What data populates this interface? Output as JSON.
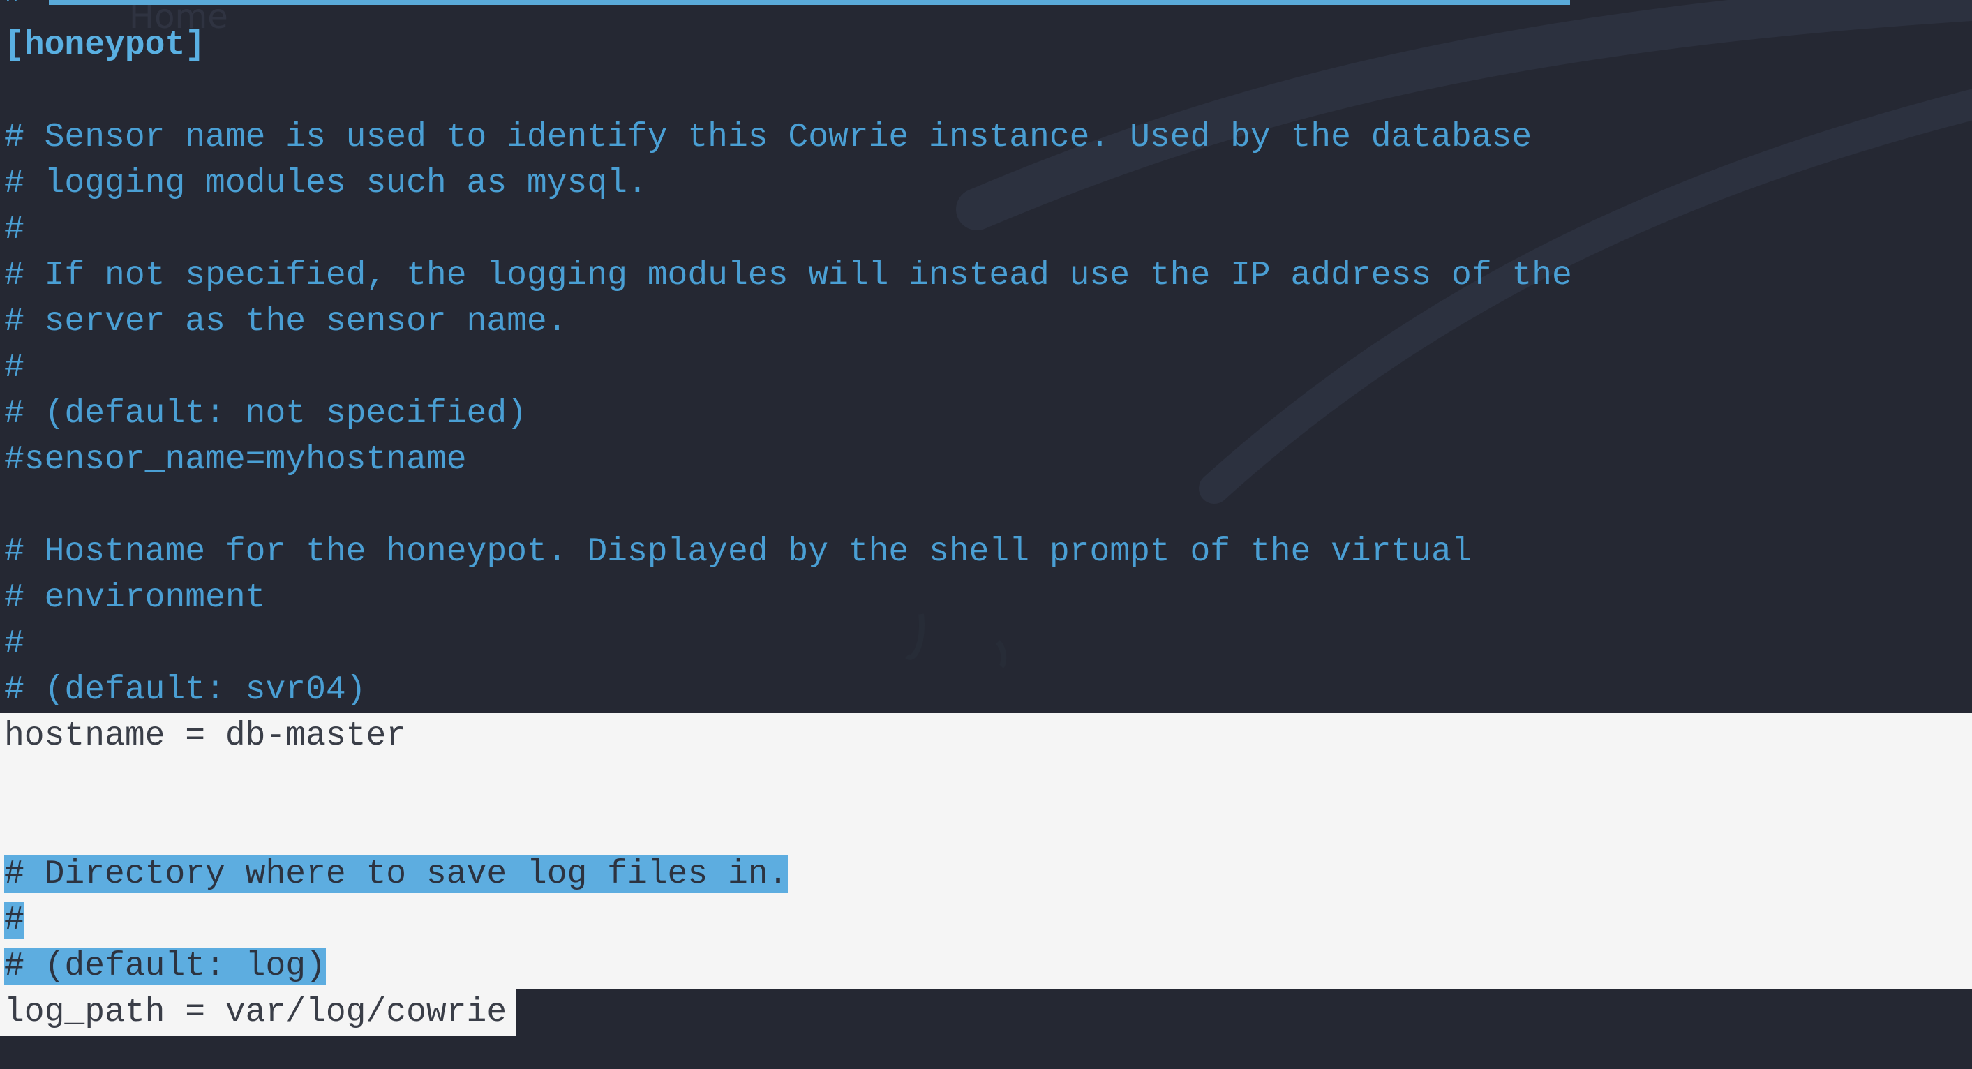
{
  "desktop": {
    "ghost_label": "Home"
  },
  "editor": {
    "top_partial_line": "#",
    "lines": [
      {
        "text": "[honeypot]",
        "kind": "section"
      },
      {
        "text": "",
        "kind": "blank"
      },
      {
        "text": "# Sensor name is used to identify this Cowrie instance. Used by the database",
        "kind": "comment"
      },
      {
        "text": "# logging modules such as mysql.",
        "kind": "comment"
      },
      {
        "text": "#",
        "kind": "comment"
      },
      {
        "text": "# If not specified, the logging modules will instead use the IP address of the",
        "kind": "comment"
      },
      {
        "text": "# server as the sensor name.",
        "kind": "comment"
      },
      {
        "text": "#",
        "kind": "comment"
      },
      {
        "text": "# (default: not specified)",
        "kind": "comment"
      },
      {
        "text": "#sensor_name=myhostname",
        "kind": "comment"
      },
      {
        "text": "",
        "kind": "blank"
      },
      {
        "text": "# Hostname for the honeypot. Displayed by the shell prompt of the virtual",
        "kind": "comment"
      },
      {
        "text": "# environment",
        "kind": "comment"
      },
      {
        "text": "#",
        "kind": "comment"
      },
      {
        "text": "# (default: svr04)",
        "kind": "comment"
      },
      {
        "text": "hostname = db-master",
        "kind": "setting"
      },
      {
        "text": "",
        "kind": "blank"
      },
      {
        "text": "",
        "kind": "blank"
      },
      {
        "text": "# Directory where to save log files in.",
        "kind": "selected-comment"
      },
      {
        "text": "#",
        "kind": "selected-comment"
      },
      {
        "text": "# (default: log)",
        "kind": "selected-comment"
      },
      {
        "text": "log_path = var/log/cowrie",
        "kind": "setting"
      }
    ]
  },
  "colors": {
    "background": "#252833",
    "comment_text": "#4a9fd4",
    "selection": "#5dade0",
    "highlight_block": "#f5f5f5",
    "highlight_text": "#3a3e48"
  }
}
